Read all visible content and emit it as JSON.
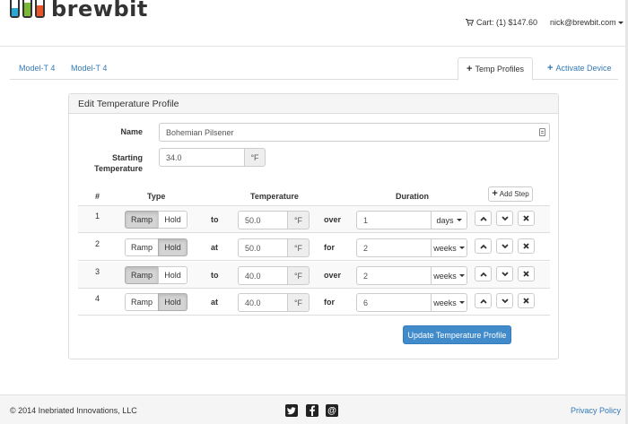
{
  "brand": {
    "name": "brewbit",
    "bar_colors": [
      "#2aa9d6",
      "#7ab835",
      "#e8552a"
    ],
    "bar_levels": [
      0.45,
      0.75,
      0.6
    ]
  },
  "header": {
    "cart": "Cart: (1) $147.60",
    "user": "nick@brewbit.com"
  },
  "tabs": {
    "devices": [
      "Model-T 4",
      "Model-T 4"
    ],
    "temp_profiles": "Temp Profiles",
    "activate": "Activate Device"
  },
  "panel": {
    "title": "Edit Temperature Profile",
    "name_label": "Name",
    "name_value": "Bohemian Pilsener",
    "start_label_1": "Starting",
    "start_label_2": "Temperature",
    "start_value": "34.0",
    "unit": "°F"
  },
  "table": {
    "headers": {
      "num": "#",
      "type": "Type",
      "temperature": "Temperature",
      "duration": "Duration"
    },
    "add_step": "Add Step",
    "rows": [
      {
        "num": "1",
        "ramp": "Ramp",
        "hold": "Hold",
        "active": "ramp",
        "conn": "to",
        "temp": "50.0",
        "unit": "°F",
        "conn2": "over",
        "duration": "1",
        "period": "days"
      },
      {
        "num": "2",
        "ramp": "Ramp",
        "hold": "Hold",
        "active": "hold",
        "conn": "at",
        "temp": "50.0",
        "unit": "°F",
        "conn2": "for",
        "duration": "2",
        "period": "weeks"
      },
      {
        "num": "3",
        "ramp": "Ramp",
        "hold": "Hold",
        "active": "ramp",
        "conn": "to",
        "temp": "40.0",
        "unit": "°F",
        "conn2": "over",
        "duration": "2",
        "period": "weeks"
      },
      {
        "num": "4",
        "ramp": "Ramp",
        "hold": "Hold",
        "active": "hold",
        "conn": "at",
        "temp": "40.0",
        "unit": "°F",
        "conn2": "for",
        "duration": "6",
        "period": "weeks"
      }
    ]
  },
  "update_button": "Update Temperature Profile",
  "footer": {
    "copyright": "© 2014 Inebriated Innovations, LLC",
    "social": [
      "twitter-icon",
      "facebook-icon",
      "email-icon"
    ],
    "privacy": "Privacy Policy"
  },
  "colors": {
    "link": "#337ab7",
    "primary": "#428bca",
    "active_toggle": "#d4d4d4"
  }
}
